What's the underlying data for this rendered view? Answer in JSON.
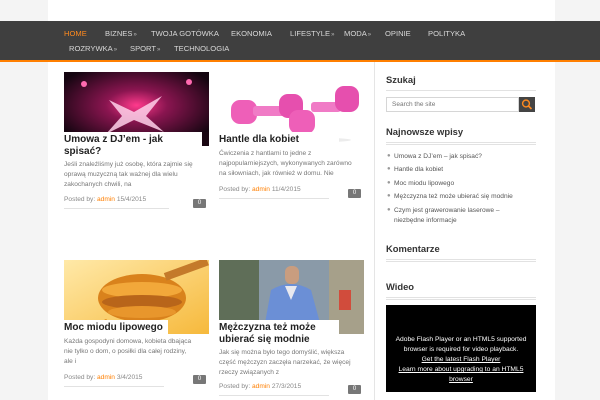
{
  "nav": {
    "row1": [
      {
        "label": "HOME",
        "active": true,
        "caret": false
      },
      {
        "label": "BIZNES",
        "caret": true
      },
      {
        "label": "TWOJA GOTÓWKA",
        "caret": false
      },
      {
        "label": "EKONOMIA",
        "caret": false
      },
      {
        "label": "LIFESTYLE",
        "caret": true
      },
      {
        "label": "MODA",
        "caret": true
      },
      {
        "label": "OPINIE",
        "caret": false
      },
      {
        "label": "POLITYKA",
        "caret": false
      }
    ],
    "row2": [
      {
        "label": "ROZRYWKA",
        "caret": true
      },
      {
        "label": "SPORT",
        "caret": true
      },
      {
        "label": "TECHNOLOGIA",
        "caret": false
      }
    ],
    "caret_glyph": "»",
    "accent_color": "#ff7f00"
  },
  "posts": [
    {
      "title_line1": "Umowa z DJ’em - jak",
      "title_line2": "spisać?",
      "excerpt_line1": "Jeśli znaleźliśmy już osobę, która zajmie się",
      "excerpt_line2": "oprawą muzyczną tak ważnej dla wielu",
      "excerpt_line3": "zakochanych chwili, na",
      "posted_by": "Posted by:",
      "author": "admin",
      "date": "15/4/2015",
      "comments": "0",
      "image": "dj-stage-photo"
    },
    {
      "title_line1": "Hantle dla kobiet",
      "title_line2": "",
      "excerpt_line1": "Ćwiczenia z hantlami to jedne z",
      "excerpt_line2": "najpopularniejszych, wykonywanych zarówno",
      "excerpt_line3": "na siłowniach, jak również w domu. Nie",
      "posted_by": "Posted by:",
      "author": "admin",
      "date": "11/4/2015",
      "comments": "0",
      "image": "pink-dumbbells-photo"
    },
    {
      "title_line1": "Moc miodu lipowego",
      "title_line2": "",
      "excerpt_line1": "Każda gospodyni domowa, kobieta dbająca",
      "excerpt_line2": "nie tylko o dom, o posiłki dla całej rodziny,",
      "excerpt_line3": "ale i",
      "posted_by": "Posted by:",
      "author": "admin",
      "date": "3/4/2015",
      "comments": "0",
      "image": "honey-dipper-photo"
    },
    {
      "title_line1": "Mężczyzna też może",
      "title_line2": "ubierać się modnie",
      "excerpt_line1": "Jak się można było tego domyślić, większa",
      "excerpt_line2": "część mężczyzn zaczęła narzekać, że więcej",
      "excerpt_line3": "rzeczy związanych z",
      "posted_by": "Posted by:",
      "author": "admin",
      "date": "27/3/2015",
      "comments": "0",
      "image": "man-shirt-photo"
    }
  ],
  "sidebar": {
    "search_title": "Szukaj",
    "search_placeholder": "Search the site",
    "recent_title": "Najnowsze wpisy",
    "recent": [
      "Umowa z DJ’em – jak spisać?",
      "Hantle dla kobiet",
      "Moc miodu lipowego",
      "Mężczyzna też może ubierać się modnie",
      "Czym jest grawerowanie laserowe –",
      "niezbędne informacje"
    ],
    "comments_title": "Komentarze",
    "video_title": "Wideo",
    "video_msg1": "Adobe Flash Player or an HTML5 supported",
    "video_msg2": "browser is required for video playback.",
    "video_link1": "Get the latest Flash Player",
    "video_link2": "Learn more about upgrading to an HTML5",
    "video_link3": "browser"
  }
}
